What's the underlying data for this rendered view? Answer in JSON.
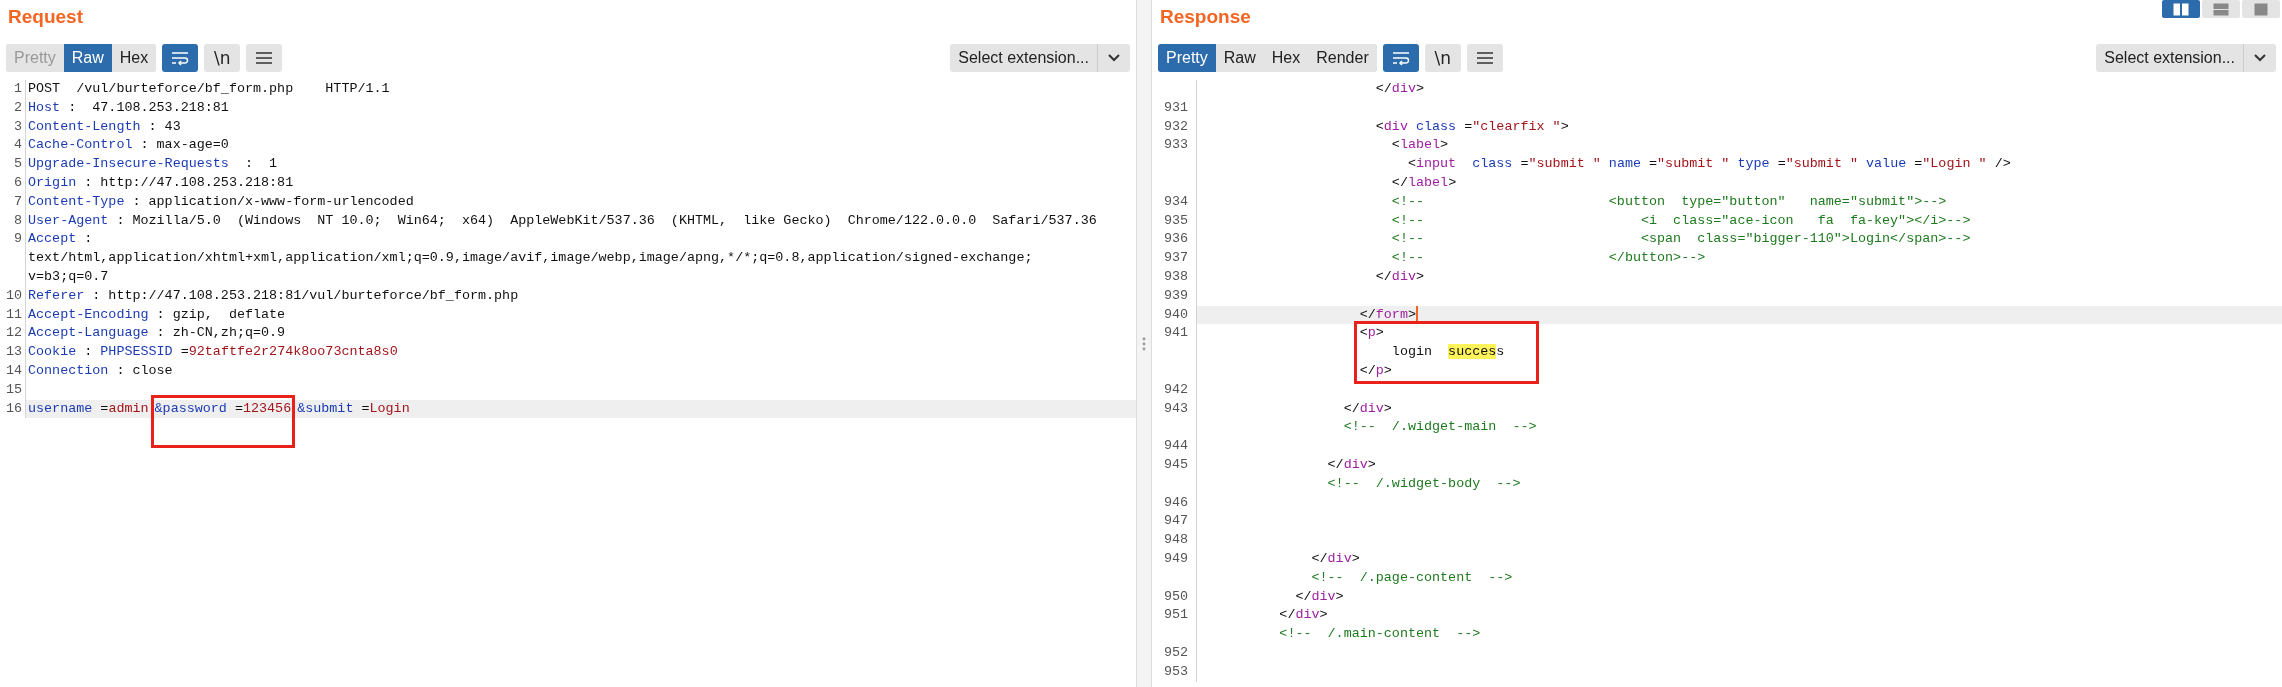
{
  "layout_buttons": [
    {
      "kind": "columns",
      "selected": true
    },
    {
      "kind": "rows",
      "selected": false
    },
    {
      "kind": "single",
      "selected": false
    }
  ],
  "panels": [
    {
      "title": "Request",
      "tabs": [
        {
          "label": "Pretty",
          "selected": false,
          "disabled": true
        },
        {
          "label": "Raw",
          "selected": true,
          "disabled": false
        },
        {
          "label": "Hex",
          "selected": false,
          "disabled": false
        }
      ],
      "tool_buttons": [
        {
          "kind": "wrap",
          "selected": true
        },
        {
          "kind": "newlines",
          "label": "\\n",
          "selected": false
        },
        {
          "kind": "menu",
          "selected": false
        }
      ],
      "select": "Select extension...",
      "lines": [
        {
          "num": "1",
          "rows": [
            {
              "tokens": [
                {
                  "kind": "plain",
                  "text": "POST  /vul/burteforce/bf_form.php    HTTP/1.1"
                }
              ]
            }
          ]
        },
        {
          "num": "2",
          "rows": [
            {
              "tokens": [
                {
                  "kind": "key",
                  "text": "Host"
                },
                {
                  "kind": "plain",
                  "text": " :  47.108.253.218:81"
                }
              ]
            }
          ]
        },
        {
          "num": "3",
          "rows": [
            {
              "tokens": [
                {
                  "kind": "key",
                  "text": "Content-Length"
                },
                {
                  "kind": "plain",
                  "text": " : 43"
                }
              ]
            }
          ]
        },
        {
          "num": "4",
          "rows": [
            {
              "tokens": [
                {
                  "kind": "key",
                  "text": "Cache-Control"
                },
                {
                  "kind": "plain",
                  "text": " : max-age=0"
                }
              ]
            }
          ]
        },
        {
          "num": "5",
          "rows": [
            {
              "tokens": [
                {
                  "kind": "key",
                  "text": "Upgrade-Insecure-Requests"
                },
                {
                  "kind": "plain",
                  "text": "  :  1"
                }
              ]
            }
          ]
        },
        {
          "num": "6",
          "rows": [
            {
              "tokens": [
                {
                  "kind": "key",
                  "text": "Origin"
                },
                {
                  "kind": "plain",
                  "text": " : http://47.108.253.218:81"
                }
              ]
            }
          ]
        },
        {
          "num": "7",
          "rows": [
            {
              "tokens": [
                {
                  "kind": "key",
                  "text": "Content-Type"
                },
                {
                  "kind": "plain",
                  "text": " : application/x-www-form-urlencoded"
                }
              ]
            }
          ]
        },
        {
          "num": "8",
          "rows": [
            {
              "tokens": [
                {
                  "kind": "key",
                  "text": "User-Agent"
                },
                {
                  "kind": "plain",
                  "text": " : Mozilla/5.0  (Windows  NT 10.0;  Win64;  x64)  AppleWebKit/537.36  (KHTML,  like Gecko)  Chrome/122.0.0.0  Safari/537.36"
                }
              ]
            }
          ]
        },
        {
          "num": "9",
          "rows": [
            {
              "tokens": [
                {
                  "kind": "key",
                  "text": "Accept"
                },
                {
                  "kind": "plain",
                  "text": " :"
                }
              ]
            },
            {
              "tokens": [
                {
                  "kind": "plain",
                  "text": "text/html,application/xhtml+xml,application/xml;q=0.9,image/avif,image/webp,image/apng,*/*;q=0.8,application/signed-exchange;"
                }
              ]
            },
            {
              "tokens": [
                {
                  "kind": "plain",
                  "text": "v=b3;q=0.7"
                }
              ]
            }
          ]
        },
        {
          "num": "10",
          "rows": [
            {
              "tokens": [
                {
                  "kind": "key",
                  "text": "Referer"
                },
                {
                  "kind": "plain",
                  "text": " : http://47.108.253.218:81/vul/burteforce/bf_form.php"
                }
              ]
            }
          ]
        },
        {
          "num": "11",
          "rows": [
            {
              "tokens": [
                {
                  "kind": "key",
                  "text": "Accept-Encoding"
                },
                {
                  "kind": "plain",
                  "text": " : gzip,  deflate"
                }
              ]
            }
          ]
        },
        {
          "num": "12",
          "rows": [
            {
              "tokens": [
                {
                  "kind": "key",
                  "text": "Accept-Language"
                },
                {
                  "kind": "plain",
                  "text": " : zh-CN,zh;q=0.9"
                }
              ]
            }
          ]
        },
        {
          "num": "13",
          "rows": [
            {
              "tokens": [
                {
                  "kind": "key",
                  "text": "Cookie"
                },
                {
                  "kind": "plain",
                  "text": " : "
                },
                {
                  "kind": "key",
                  "text": "PHPSESSID"
                },
                {
                  "kind": "plain",
                  "text": " ="
                },
                {
                  "kind": "str",
                  "text": "92taftfe2r274k8oo73cnta8s0"
                }
              ]
            }
          ]
        },
        {
          "num": "14",
          "rows": [
            {
              "tokens": [
                {
                  "kind": "key",
                  "text": "Connection"
                },
                {
                  "kind": "plain",
                  "text": " : close"
                }
              ]
            }
          ]
        },
        {
          "num": "15"
        },
        {
          "num": "16",
          "current": true,
          "rows": [
            {
              "tokens": [
                {
                  "kind": "key",
                  "text": "username"
                },
                {
                  "kind": "plain",
                  "text": " ="
                },
                {
                  "kind": "str",
                  "text": "admin"
                },
                {
                  "kind": "box",
                  "tokens": [
                    {
                      "kind": "key",
                      "text": "&password"
                    },
                    {
                      "kind": "plain",
                      "text": " ="
                    },
                    {
                      "kind": "str",
                      "text": "123456"
                    }
                  ]
                },
                {
                  "kind": "key",
                  "text": "&submit"
                },
                {
                  "kind": "plain",
                  "text": " ="
                },
                {
                  "kind": "str",
                  "text": "Login"
                }
              ]
            }
          ]
        }
      ]
    },
    {
      "title": "Response",
      "tabs": [
        {
          "label": "Pretty",
          "selected": true,
          "disabled": false
        },
        {
          "label": "Raw",
          "selected": false,
          "disabled": false
        },
        {
          "label": "Hex",
          "selected": false,
          "disabled": false
        },
        {
          "label": "Render",
          "selected": false,
          "disabled": false
        }
      ],
      "tool_buttons": [
        {
          "kind": "wrap",
          "selected": true
        },
        {
          "kind": "newlines",
          "label": "\\n",
          "selected": false
        },
        {
          "kind": "menu",
          "selected": false
        }
      ],
      "select": "Select extension...",
      "lines": [
        {
          "rows": [
            {
              "tokens": [
                {
                  "kind": "plain",
                  "text": "                      </"
                },
                {
                  "kind": "tag",
                  "text": "div"
                },
                {
                  "kind": "plain",
                  "text": ">"
                }
              ]
            }
          ]
        },
        {
          "num": "931"
        },
        {
          "num": "932",
          "rows": [
            {
              "tokens": [
                {
                  "kind": "plain",
                  "text": "                      <"
                },
                {
                  "kind": "tag",
                  "text": "div"
                },
                {
                  "kind": "attr",
                  "text": " class"
                },
                {
                  "kind": "plain",
                  "text": " ="
                },
                {
                  "kind": "str",
                  "text": "\"clearfix \""
                },
                {
                  "kind": "plain",
                  "text": ">"
                }
              ]
            }
          ]
        },
        {
          "num": "933",
          "rows": [
            {
              "tokens": [
                {
                  "kind": "plain",
                  "text": "                        <"
                },
                {
                  "kind": "tag",
                  "text": "label"
                },
                {
                  "kind": "plain",
                  "text": ">"
                }
              ]
            },
            {
              "tokens": [
                {
                  "kind": "plain",
                  "text": "                          <"
                },
                {
                  "kind": "tag",
                  "text": "input"
                },
                {
                  "kind": "attr",
                  "text": "  class"
                },
                {
                  "kind": "plain",
                  "text": " ="
                },
                {
                  "kind": "str",
                  "text": "\"submit \""
                },
                {
                  "kind": "attr",
                  "text": " name"
                },
                {
                  "kind": "plain",
                  "text": " ="
                },
                {
                  "kind": "str",
                  "text": "\"submit \""
                },
                {
                  "kind": "attr",
                  "text": " type"
                },
                {
                  "kind": "plain",
                  "text": " ="
                },
                {
                  "kind": "str",
                  "text": "\"submit \""
                },
                {
                  "kind": "attr",
                  "text": " value"
                },
                {
                  "kind": "plain",
                  "text": " ="
                },
                {
                  "kind": "str",
                  "text": "\"Login \""
                },
                {
                  "kind": "plain",
                  "text": " />"
                }
              ]
            },
            {
              "tokens": [
                {
                  "kind": "plain",
                  "text": "                        </"
                },
                {
                  "kind": "tag",
                  "text": "label"
                },
                {
                  "kind": "plain",
                  "text": ">"
                }
              ]
            }
          ]
        },
        {
          "num": "934",
          "rows": [
            {
              "tokens": [
                {
                  "kind": "comment",
                  "text": "                        <!--                       <button  type=\"button\"   name=\"submit\">-->"
                }
              ]
            }
          ]
        },
        {
          "num": "935",
          "rows": [
            {
              "tokens": [
                {
                  "kind": "comment",
                  "text": "                        <!--                           <i  class=\"ace-icon   fa  fa-key\"></i>-->"
                }
              ]
            }
          ]
        },
        {
          "num": "936",
          "rows": [
            {
              "tokens": [
                {
                  "kind": "comment",
                  "text": "                        <!--                           <span  class=\"bigger-110\">Login</span>-->"
                }
              ]
            }
          ]
        },
        {
          "num": "937",
          "rows": [
            {
              "tokens": [
                {
                  "kind": "comment",
                  "text": "                        <!--                       </button>-->"
                }
              ]
            }
          ]
        },
        {
          "num": "938",
          "rows": [
            {
              "tokens": [
                {
                  "kind": "plain",
                  "text": "                      </"
                },
                {
                  "kind": "tag",
                  "text": "div"
                },
                {
                  "kind": "plain",
                  "text": ">"
                }
              ]
            }
          ]
        },
        {
          "num": "939"
        },
        {
          "num": "940",
          "current": true,
          "rows": [
            {
              "tokens": [
                {
                  "kind": "plain",
                  "text": "                    </"
                },
                {
                  "kind": "tag",
                  "text": "form"
                },
                {
                  "kind": "plain",
                  "text": ">"
                },
                {
                  "kind": "caret"
                }
              ]
            }
          ]
        },
        {
          "num": "941",
          "boxed": true,
          "rows": [
            {
              "tokens": [
                {
                  "kind": "plain",
                  "text": "                    <"
                },
                {
                  "kind": "tag",
                  "text": "p"
                },
                {
                  "kind": "plain",
                  "text": ">"
                }
              ]
            },
            {
              "tokens": [
                {
                  "kind": "plain",
                  "text": "                        login  "
                },
                {
                  "kind": "match",
                  "text": "succes"
                },
                {
                  "kind": "plain",
                  "text": "s"
                }
              ]
            },
            {
              "tokens": [
                {
                  "kind": "plain",
                  "text": "                    </"
                },
                {
                  "kind": "tag",
                  "text": "p"
                },
                {
                  "kind": "plain",
                  "text": ">"
                }
              ]
            }
          ]
        },
        {
          "num": "942"
        },
        {
          "num": "943",
          "rows": [
            {
              "tokens": [
                {
                  "kind": "plain",
                  "text": "                  </"
                },
                {
                  "kind": "tag",
                  "text": "div"
                },
                {
                  "kind": "plain",
                  "text": ">"
                }
              ]
            },
            {
              "tokens": [
                {
                  "kind": "comment",
                  "text": "                  <!--  /.widget-main  -->"
                }
              ]
            }
          ]
        },
        {
          "num": "944"
        },
        {
          "num": "945",
          "rows": [
            {
              "tokens": [
                {
                  "kind": "plain",
                  "text": "                </"
                },
                {
                  "kind": "tag",
                  "text": "div"
                },
                {
                  "kind": "plain",
                  "text": ">"
                }
              ]
            },
            {
              "tokens": [
                {
                  "kind": "comment",
                  "text": "                <!--  /.widget-body  -->"
                }
              ]
            }
          ]
        },
        {
          "num": "946"
        },
        {
          "num": "947"
        },
        {
          "num": "948"
        },
        {
          "num": "949",
          "rows": [
            {
              "tokens": [
                {
                  "kind": "plain",
                  "text": "              </"
                },
                {
                  "kind": "tag",
                  "text": "div"
                },
                {
                  "kind": "plain",
                  "text": ">"
                }
              ]
            },
            {
              "tokens": [
                {
                  "kind": "comment",
                  "text": "              <!--  /.page-content  -->"
                }
              ]
            }
          ]
        },
        {
          "num": "950",
          "rows": [
            {
              "tokens": [
                {
                  "kind": "plain",
                  "text": "            </"
                },
                {
                  "kind": "tag",
                  "text": "div"
                },
                {
                  "kind": "plain",
                  "text": ">"
                }
              ]
            }
          ]
        },
        {
          "num": "951",
          "rows": [
            {
              "tokens": [
                {
                  "kind": "plain",
                  "text": "          </"
                },
                {
                  "kind": "tag",
                  "text": "div"
                },
                {
                  "kind": "plain",
                  "text": ">"
                }
              ]
            },
            {
              "tokens": [
                {
                  "kind": "comment",
                  "text": "          <!--  /.main-content  -->"
                }
              ]
            }
          ]
        },
        {
          "num": "952"
        },
        {
          "num": "953"
        }
      ]
    }
  ]
}
